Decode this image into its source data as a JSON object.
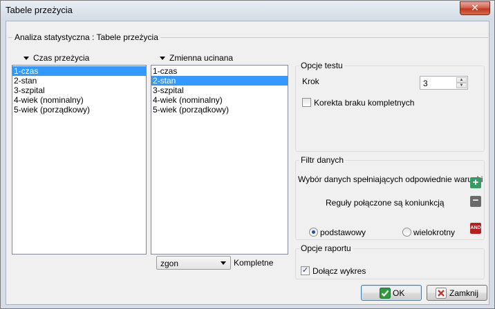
{
  "window": {
    "title": "Tabele przeżycia",
    "close_glyph": "✕"
  },
  "main_group": {
    "title": "Analiza statystyczna : Tabele przeżycia"
  },
  "survival_list": {
    "label": "Czas przeżycia",
    "items": [
      "1-czas",
      "2-stan",
      "3-szpital",
      "4-wiek (nominalny)",
      "5-wiek (porządkowy)"
    ],
    "selected_index": 0
  },
  "censor_list": {
    "label": "Zmienna ucinana",
    "items": [
      "1-czas",
      "2-stan",
      "3-szpital",
      "4-wiek (nominalny)",
      "5-wiek (porządkowy)"
    ],
    "selected_index": 1
  },
  "censor_select": {
    "value": "zgon",
    "trailing_label": "Kompletne"
  },
  "test_options": {
    "title": "Opcje testu",
    "step_label": "Krok",
    "step_value": "3",
    "correction_label": "Korekta braku kompletnych",
    "correction_checked": false
  },
  "data_filter": {
    "title": "Filtr danych",
    "select_label": "Wybór danych spełniających odpowiednie warunki",
    "rules_label": "Reguły połączone są koniunkcją",
    "and_icon_text": "AND",
    "radio_basic": "podstawowy",
    "radio_multi": "wielokrotny",
    "selected_mode": "podstawowy"
  },
  "report_options": {
    "title": "Opcje raportu",
    "attach_chart_label": "Dołącz wykres",
    "attach_chart_checked": true
  },
  "buttons": {
    "ok": "OK",
    "close": "Zamknij"
  },
  "colors": {
    "selection": "#3399ff",
    "ok_check": "#2f9a3f",
    "close_x": "#c0392b",
    "plus_icon": "#3a9a65",
    "minus_icon": "#6b6b6b",
    "and_icon": "#b41f1f"
  }
}
